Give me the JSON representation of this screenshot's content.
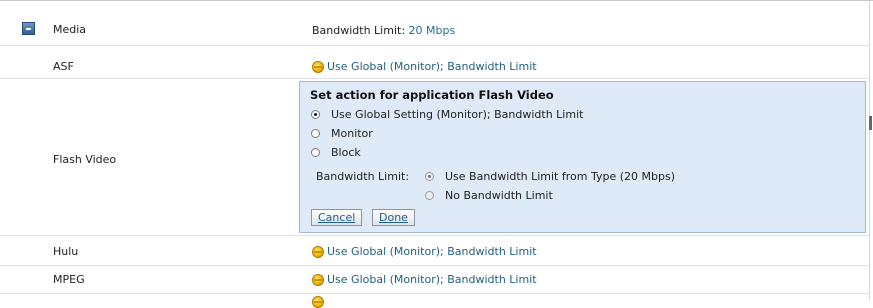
{
  "media_group": {
    "label": "Media",
    "bandwidth_prefix": "Bandwidth Limit:",
    "bandwidth_value": "20 Mbps"
  },
  "rows": [
    {
      "name": "ASF",
      "action": "Use Global (Monitor); Bandwidth Limit"
    },
    {
      "name": "Flash Video"
    },
    {
      "name": "Hulu",
      "action": "Use Global (Monitor); Bandwidth Limit"
    },
    {
      "name": "MPEG",
      "action": "Use Global (Monitor); Bandwidth Limit"
    }
  ],
  "panel": {
    "title": "Set action for application Flash Video",
    "options": [
      {
        "label": "Use Global Setting (Monitor); Bandwidth Limit",
        "selected": true
      },
      {
        "label": "Monitor",
        "selected": false
      },
      {
        "label": "Block",
        "selected": false
      }
    ],
    "bandwidth_label": "Bandwidth Limit:",
    "bandwidth_options": [
      {
        "label": "Use Bandwidth Limit from Type (20 Mbps)",
        "selected": true
      },
      {
        "label": "No Bandwidth Limit",
        "selected": false
      }
    ],
    "cancel_label": "Cancel",
    "done_label": "Done"
  },
  "icons": {
    "action_icon": "globe-icon",
    "collapse_icon": "collapse-minus-icon"
  }
}
